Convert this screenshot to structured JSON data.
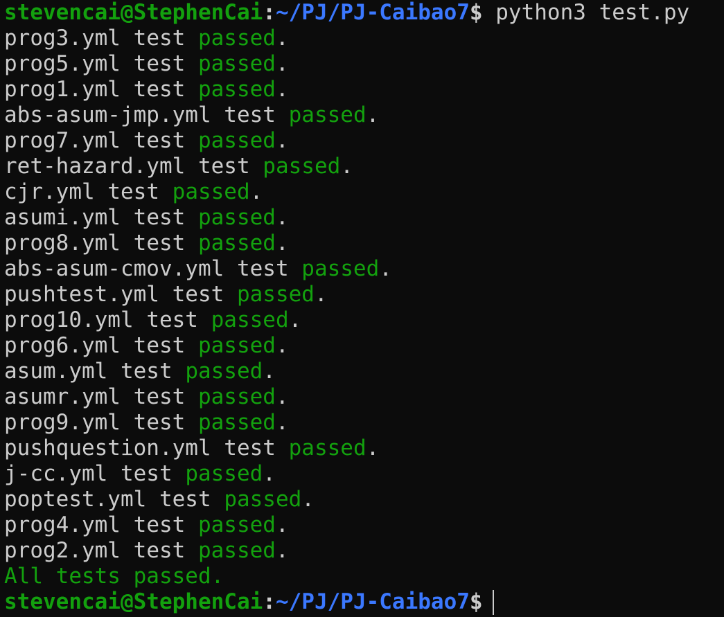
{
  "prompt": {
    "user_host": "stevencai@StephenCai",
    "separator": ":",
    "path": "~/PJ/PJ-Caibao7",
    "symbol": "$",
    "command": " python3 test.py"
  },
  "results": [
    {
      "file": "prog3.yml",
      "word": "test",
      "status": "passed",
      "end": "."
    },
    {
      "file": "prog5.yml",
      "word": "test",
      "status": "passed",
      "end": "."
    },
    {
      "file": "prog1.yml",
      "word": "test",
      "status": "passed",
      "end": "."
    },
    {
      "file": "abs-asum-jmp.yml",
      "word": "test",
      "status": "passed",
      "end": "."
    },
    {
      "file": "prog7.yml",
      "word": "test",
      "status": "passed",
      "end": "."
    },
    {
      "file": "ret-hazard.yml",
      "word": "test",
      "status": "passed",
      "end": "."
    },
    {
      "file": "cjr.yml",
      "word": "test",
      "status": "passed",
      "end": "."
    },
    {
      "file": "asumi.yml",
      "word": "test",
      "status": "passed",
      "end": "."
    },
    {
      "file": "prog8.yml",
      "word": "test",
      "status": "passed",
      "end": "."
    },
    {
      "file": "abs-asum-cmov.yml",
      "word": "test",
      "status": "passed",
      "end": "."
    },
    {
      "file": "pushtest.yml",
      "word": "test",
      "status": "passed",
      "end": "."
    },
    {
      "file": "prog10.yml",
      "word": "test",
      "status": "passed",
      "end": "."
    },
    {
      "file": "prog6.yml",
      "word": "test",
      "status": "passed",
      "end": "."
    },
    {
      "file": "asum.yml",
      "word": "test",
      "status": "passed",
      "end": "."
    },
    {
      "file": "asumr.yml",
      "word": "test",
      "status": "passed",
      "end": "."
    },
    {
      "file": "prog9.yml",
      "word": "test",
      "status": "passed",
      "end": "."
    },
    {
      "file": "pushquestion.yml",
      "word": "test",
      "status": "passed",
      "end": "."
    },
    {
      "file": "j-cc.yml",
      "word": "test",
      "status": "passed",
      "end": "."
    },
    {
      "file": "poptest.yml",
      "word": "test",
      "status": "passed",
      "end": "."
    },
    {
      "file": "prog4.yml",
      "word": "test",
      "status": "passed",
      "end": "."
    },
    {
      "file": "prog2.yml",
      "word": "test",
      "status": "passed",
      "end": "."
    }
  ],
  "summary": "All tests passed.",
  "colors": {
    "background": "#0c0c0c",
    "text": "#cccccc",
    "prompt_user": "#13a10e",
    "prompt_path": "#3b78ff",
    "passed": "#13a10e"
  }
}
